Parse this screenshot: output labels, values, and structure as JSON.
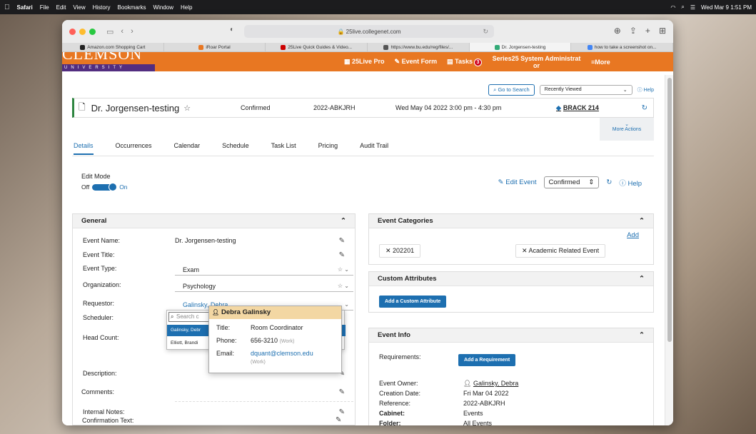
{
  "menubar": {
    "apple": "",
    "items": [
      "Safari",
      "File",
      "Edit",
      "View",
      "History",
      "Bookmarks",
      "Window",
      "Help"
    ],
    "clock": "Wed Mar 9  1:51 PM"
  },
  "browser": {
    "url": "25live.collegenet.com",
    "tabs": [
      "Amazon.com Shopping Cart",
      "iRoar Portal",
      "25Live Quick Guides & Video...",
      "https://www.bu.edu/reg/files/...",
      "Dr. Jorgensen-testing",
      "how to take a screenshot on..."
    ],
    "active_tab": 4
  },
  "header": {
    "logo_top": "CLEMSON",
    "logo_bottom": "UNIVERSITY",
    "nav_25live": "25Live Pro",
    "nav_event_form": "Event Form",
    "nav_tasks": "Tasks",
    "tasks_count": "3",
    "user": "Series25 System Administrat or",
    "more": "More"
  },
  "search": {
    "go_to_search": "Go to Search",
    "recently_viewed": "Recently Viewed",
    "help": "Help"
  },
  "event": {
    "name": "Dr. Jorgensen-testing",
    "state": "Confirmed",
    "reference": "2022-ABKJRH",
    "datetime": "Wed May 04 2022 3:00 pm - 4:30 pm",
    "location": "BRACK 214",
    "more_actions": "More Actions"
  },
  "detail_tabs": [
    "Details",
    "Occurrences",
    "Calendar",
    "Schedule",
    "Task List",
    "Pricing",
    "Audit Trail"
  ],
  "edit_mode": {
    "label": "Edit Mode",
    "off": "Off",
    "on": "On",
    "edit_event": "Edit Event",
    "state_select": "Confirmed",
    "help": "Help"
  },
  "general": {
    "title": "General",
    "event_name_label": "Event Name:",
    "event_name": "Dr. Jorgensen-testing",
    "event_title_label": "Event Title:",
    "event_type_label": "Event Type:",
    "event_type": "Exam",
    "organization_label": "Organization:",
    "organization": "Psychology",
    "requestor_label": "Requestor:",
    "requestor": "Galinsky, Debra",
    "scheduler_label": "Scheduler:",
    "head_count_label": "Head Count:",
    "description_label": "Description:",
    "comments_label": "Comments:",
    "internal_notes_label": "Internal Notes:",
    "confirmation_text_label": "Confirmation Text:"
  },
  "dropdown": {
    "search_placeholder": "Search c",
    "option1": "Galinsky, Debr",
    "option2": "Elliott, Brandi"
  },
  "contact_card": {
    "name": "Debra Galinsky",
    "title_label": "Title:",
    "title": "Room Coordinator",
    "phone_label": "Phone:",
    "phone": "656-3210",
    "phone_type": "(Work)",
    "email_label": "Email:",
    "email": "dquant@clemson.edu",
    "email_type": "(Work)"
  },
  "categories": {
    "title": "Event Categories",
    "add": "Add",
    "chip1": "202201",
    "chip2": "Academic Related Event"
  },
  "custom_attributes": {
    "title": "Custom Attributes",
    "add_button": "Add a Custom Attribute"
  },
  "event_info": {
    "title": "Event Info",
    "requirements_label": "Requirements:",
    "add_requirement": "Add a Requirement",
    "owner_label": "Event Owner:",
    "owner": "Galinsky, Debra",
    "creation_label": "Creation Date:",
    "creation": "Fri Mar 04 2022",
    "reference_label": "Reference:",
    "reference": "2022-ABKJRH",
    "cabinet_label": "Cabinet:",
    "cabinet": "Events",
    "folder_label": "Folder:",
    "folder": "All Events"
  }
}
